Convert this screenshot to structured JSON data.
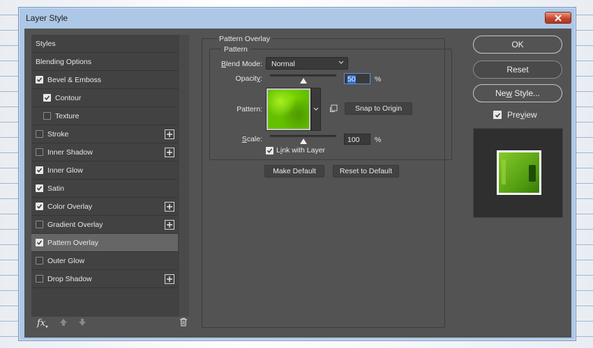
{
  "window": {
    "title": "Layer Style"
  },
  "styles_list": {
    "items": [
      {
        "label": "Styles",
        "checkbox": false,
        "checked": false,
        "indent": false,
        "plus": false,
        "selected": false
      },
      {
        "label": "Blending Options",
        "checkbox": false,
        "checked": false,
        "indent": false,
        "plus": false,
        "selected": false
      },
      {
        "label": "Bevel & Emboss",
        "checkbox": true,
        "checked": true,
        "indent": false,
        "plus": false,
        "selected": false
      },
      {
        "label": "Contour",
        "checkbox": true,
        "checked": true,
        "indent": true,
        "plus": false,
        "selected": false
      },
      {
        "label": "Texture",
        "checkbox": true,
        "checked": false,
        "indent": true,
        "plus": false,
        "selected": false
      },
      {
        "label": "Stroke",
        "checkbox": true,
        "checked": false,
        "indent": false,
        "plus": true,
        "selected": false
      },
      {
        "label": "Inner Shadow",
        "checkbox": true,
        "checked": false,
        "indent": false,
        "plus": true,
        "selected": false
      },
      {
        "label": "Inner Glow",
        "checkbox": true,
        "checked": true,
        "indent": false,
        "plus": false,
        "selected": false
      },
      {
        "label": "Satin",
        "checkbox": true,
        "checked": true,
        "indent": false,
        "plus": false,
        "selected": false
      },
      {
        "label": "Color Overlay",
        "checkbox": true,
        "checked": true,
        "indent": false,
        "plus": true,
        "selected": false
      },
      {
        "label": "Gradient Overlay",
        "checkbox": true,
        "checked": false,
        "indent": false,
        "plus": true,
        "selected": false
      },
      {
        "label": "Pattern Overlay",
        "checkbox": true,
        "checked": true,
        "indent": false,
        "plus": false,
        "selected": true
      },
      {
        "label": "Outer Glow",
        "checkbox": true,
        "checked": false,
        "indent": false,
        "plus": false,
        "selected": false
      },
      {
        "label": "Drop Shadow",
        "checkbox": true,
        "checked": false,
        "indent": false,
        "plus": true,
        "selected": false
      }
    ],
    "toolbar_icons": [
      "fx-icon",
      "arrow-up-icon",
      "arrow-down-icon",
      "trash-icon"
    ],
    "fx_label": "fx"
  },
  "pattern_overlay": {
    "group_title": "Pattern Overlay",
    "subgroup_title": "Pattern",
    "blend_mode_label": "Blend Mode:",
    "blend_mode_value": "Normal",
    "opacity_label": "Opacity:",
    "opacity_value": "50",
    "opacity_fraction": 0.5,
    "percent": "%",
    "pattern_label": "Pattern:",
    "snap_to_origin": "Snap to Origin",
    "scale_label": "Scale:",
    "scale_value": "100",
    "scale_fraction": 0.5,
    "link_with_layer": "Link with Layer",
    "link_with_layer_checked": true,
    "make_default": "Make Default",
    "reset_to_default": "Reset to Default",
    "pattern_color": "#64c000"
  },
  "buttons": {
    "ok": "OK",
    "reset": "Reset",
    "new_style": "New Style...",
    "preview": "Preview",
    "preview_checked": true
  }
}
